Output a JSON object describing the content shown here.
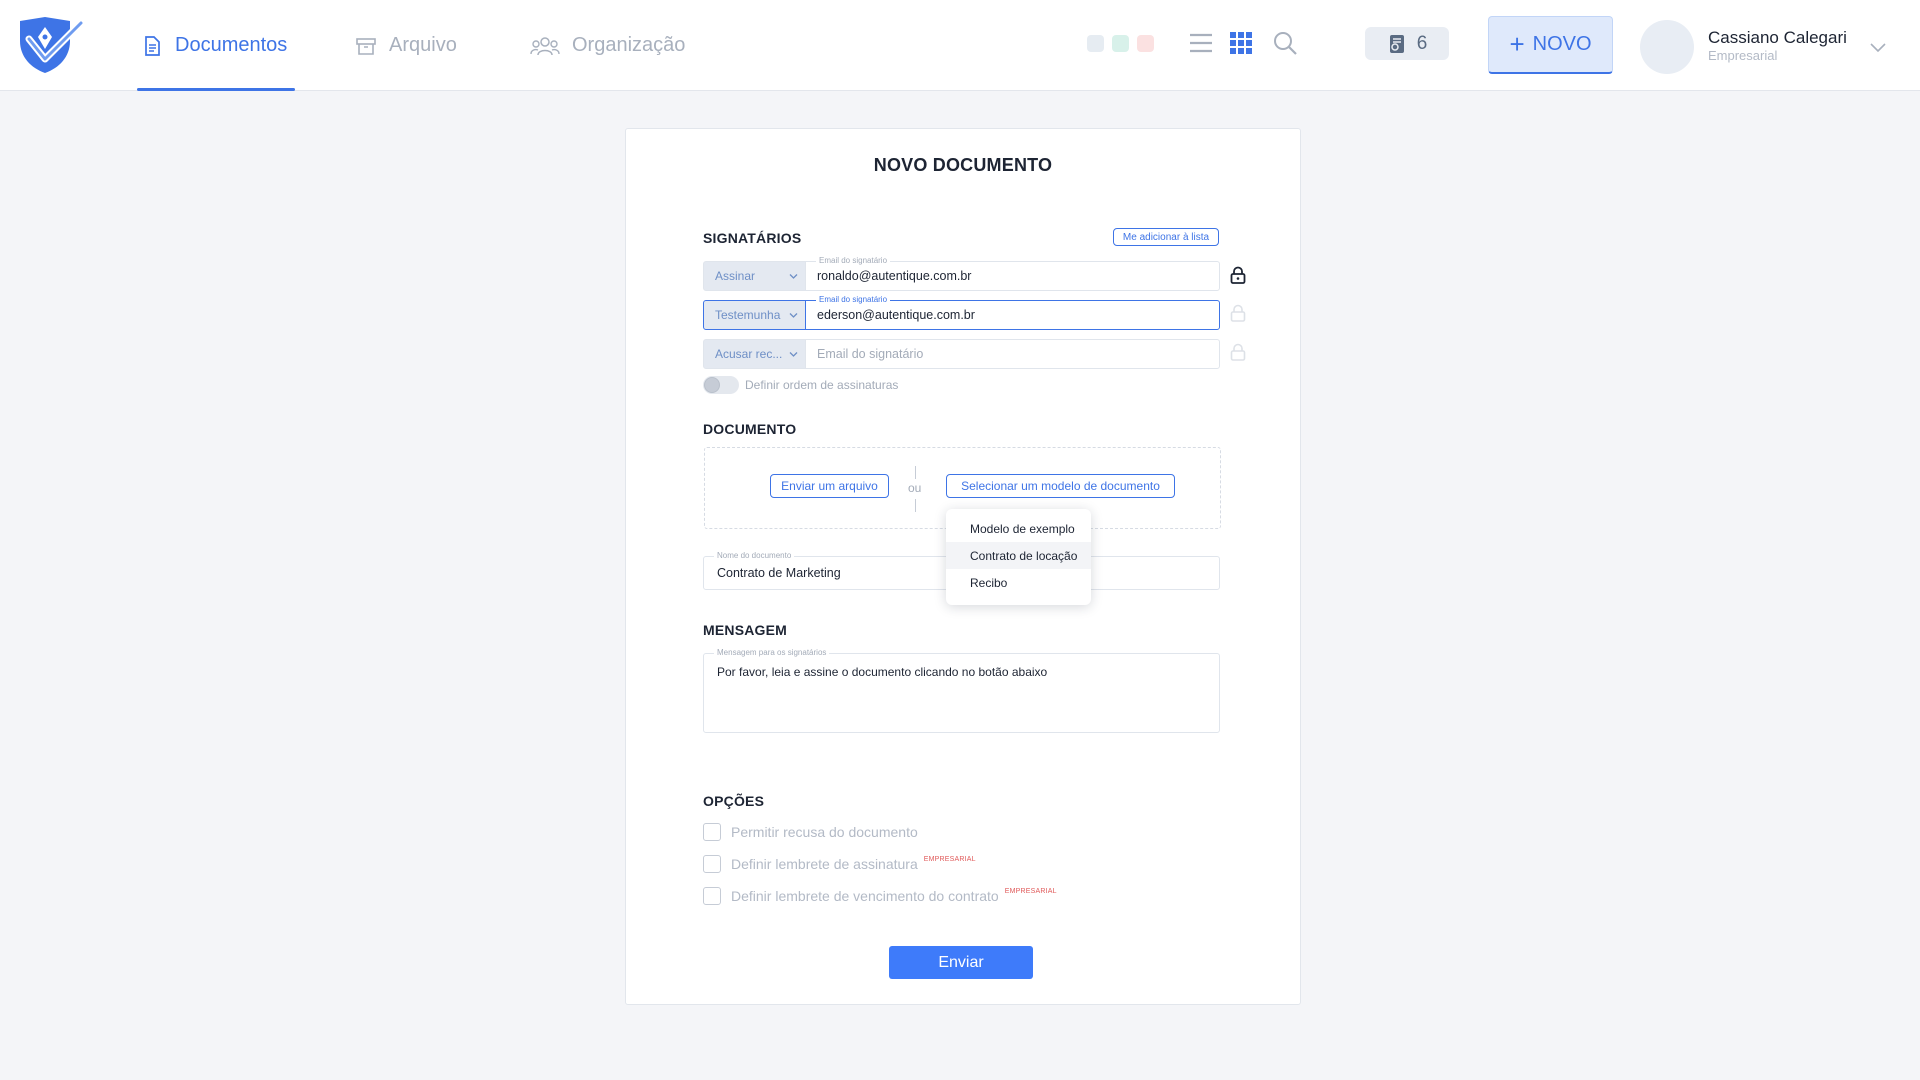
{
  "app": {
    "logo_icon": "autentique-shield-logo-icon",
    "accent_color": "#3e74e6"
  },
  "nav": {
    "tabs": [
      {
        "label": "Documentos",
        "icon": "document-icon",
        "active": true
      },
      {
        "label": "Arquivo",
        "icon": "archive-icon",
        "active": false
      },
      {
        "label": "Organização",
        "icon": "group-icon",
        "active": false
      }
    ]
  },
  "toolbar": {
    "theme_colors": [
      "#e6ecf2",
      "#d8f1ea",
      "#fbe1e1"
    ],
    "list_view_icon": "list-view-icon",
    "grid_view_icon": "grid-view-icon",
    "search_icon": "search-icon",
    "notification_count": "6",
    "new_button_label": "NOVO"
  },
  "user": {
    "name": "Cassiano Calegari",
    "plan": "Empresarial"
  },
  "form": {
    "title": "NOVO DOCUMENTO",
    "signers_section": "SIGNATÁRIOS",
    "add_me_label": "Me adicionar à lista",
    "signers": [
      {
        "action": "Assinar",
        "field_label": "Email do signatário",
        "email": "ronaldo@autentique.com.br",
        "locked": true
      },
      {
        "action": "Testemunha",
        "field_label": "Email do signatário",
        "email": "ederson@autentique.com.br",
        "locked": false
      },
      {
        "action": "Acusar rec...",
        "placeholder": "Email do signatário",
        "locked": false
      }
    ],
    "order_toggle_label": "Definir ordem de assinaturas",
    "document_section": "DOCUMENTO",
    "upload_button": "Enviar um arquivo",
    "or_text": "ou",
    "template_button": "Selecionar um modelo de documento",
    "template_options": [
      "Modelo de exemplo",
      "Contrato de locação",
      "Recibo"
    ],
    "doc_name_label": "Nome do documento",
    "doc_name_value": "Contrato de Marketing",
    "message_section": "MENSAGEM",
    "message_label": "Mensagem para os signatários",
    "message_value": "Por favor, leia e assine o documento clicando no botão abaixo",
    "options_section": "OPÇÕES",
    "options": [
      {
        "label": "Permitir recusa do documento",
        "badge": ""
      },
      {
        "label": "Definir lembrete de assinatura",
        "badge": "EMPRESARIAL"
      },
      {
        "label": "Definir lembrete de vencimento do contrato",
        "badge": "EMPRESARIAL"
      }
    ],
    "submit_label": "Enviar"
  }
}
